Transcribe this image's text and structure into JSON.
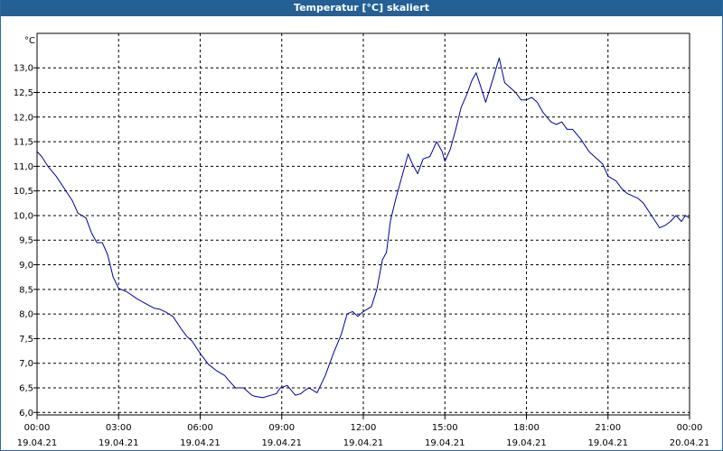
{
  "window": {
    "title": "Temperatur [°C] skaliert"
  },
  "colors": {
    "titlebar": "#245f95",
    "line": "#0000a0",
    "grid": "#000000"
  },
  "chart_data": {
    "type": "line",
    "title": "Temperatur [°C] skaliert",
    "ylabel": "°C",
    "xlabel": "",
    "ylim": [
      5.95,
      13.7
    ],
    "xlim": [
      0,
      24
    ],
    "grid": true,
    "grid_style": "dashed",
    "legend": "none",
    "y_ticks": [
      "6,0",
      "6,5",
      "7,0",
      "7,5",
      "8,0",
      "8,5",
      "9,0",
      "9,5",
      "10,0",
      "10,5",
      "11,0",
      "11,5",
      "12,0",
      "12,5",
      "13,0"
    ],
    "x_ticks": [
      {
        "time": "00:00",
        "date": "19.04.21"
      },
      {
        "time": "03:00",
        "date": "19.04.21"
      },
      {
        "time": "06:00",
        "date": "19.04.21"
      },
      {
        "time": "09:00",
        "date": "19.04.21"
      },
      {
        "time": "12:00",
        "date": "19.04.21"
      },
      {
        "time": "15:00",
        "date": "19.04.21"
      },
      {
        "time": "18:00",
        "date": "19.04.21"
      },
      {
        "time": "21:00",
        "date": "19.04.21"
      },
      {
        "time": "00:00",
        "date": "20.04.21"
      }
    ],
    "series": [
      {
        "x": [
          0.0,
          0.17,
          0.4,
          0.7,
          1.0,
          1.3,
          1.5,
          1.8,
          2.0,
          2.2,
          2.4,
          2.6,
          2.8,
          3.0,
          3.3,
          3.7,
          4.1,
          4.3,
          4.5,
          4.7,
          5.0,
          5.3,
          5.5,
          5.7,
          6.0,
          6.3,
          6.6,
          6.9,
          7.1,
          7.3,
          7.6,
          7.9,
          8.0,
          8.3,
          8.6,
          8.8,
          8.95,
          9.2,
          9.5,
          9.7,
          9.85,
          10.0,
          10.3,
          10.6,
          10.9,
          11.2,
          11.4,
          11.6,
          11.8,
          12.0,
          12.3,
          12.5,
          12.7,
          12.85,
          13.0,
          13.2,
          13.4,
          13.65,
          13.8,
          14.0,
          14.2,
          14.45,
          14.7,
          14.9,
          15.0,
          15.2,
          15.4,
          15.6,
          15.8,
          16.0,
          16.15,
          16.3,
          16.5,
          16.7,
          17.0,
          17.2,
          17.4,
          17.6,
          17.8,
          18.0,
          18.2,
          18.4,
          18.6,
          18.9,
          19.1,
          19.3,
          19.5,
          19.7,
          20.0,
          20.3,
          20.5,
          20.8,
          21.0,
          21.3,
          21.5,
          21.7,
          21.9,
          22.1,
          22.3,
          22.6,
          22.9,
          23.1,
          23.3,
          23.5,
          23.7,
          23.85,
          24.0
        ],
        "y": [
          11.3,
          11.2,
          11.0,
          10.8,
          10.55,
          10.3,
          10.05,
          9.95,
          9.65,
          9.45,
          9.45,
          9.2,
          8.75,
          8.52,
          8.45,
          8.3,
          8.18,
          8.12,
          8.1,
          8.05,
          7.95,
          7.7,
          7.55,
          7.45,
          7.2,
          6.98,
          6.85,
          6.75,
          6.62,
          6.5,
          6.5,
          6.35,
          6.33,
          6.3,
          6.35,
          6.38,
          6.5,
          6.55,
          6.35,
          6.38,
          6.45,
          6.5,
          6.4,
          6.75,
          7.2,
          7.6,
          8.0,
          8.05,
          7.95,
          8.05,
          8.15,
          8.5,
          9.1,
          9.25,
          9.9,
          10.35,
          10.75,
          11.25,
          11.05,
          10.85,
          11.15,
          11.2,
          11.5,
          11.3,
          11.1,
          11.35,
          11.75,
          12.2,
          12.45,
          12.75,
          12.9,
          12.65,
          12.3,
          12.65,
          13.2,
          12.7,
          12.6,
          12.5,
          12.35,
          12.35,
          12.4,
          12.3,
          12.1,
          11.9,
          11.85,
          11.9,
          11.75,
          11.75,
          11.55,
          11.3,
          11.2,
          11.05,
          10.8,
          10.7,
          10.55,
          10.45,
          10.4,
          10.35,
          10.25,
          10.0,
          9.75,
          9.8,
          9.88,
          10.0,
          9.88,
          10.0,
          9.95
        ]
      }
    ]
  }
}
